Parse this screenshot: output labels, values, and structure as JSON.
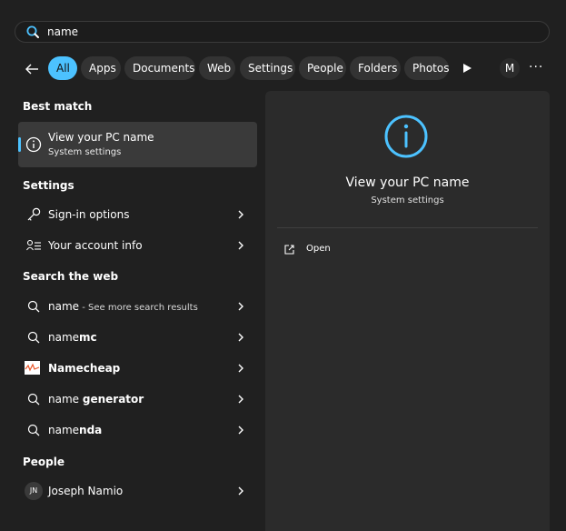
{
  "search": {
    "query": "name"
  },
  "filters": {
    "chips": [
      "All",
      "Apps",
      "Documents",
      "Web",
      "Settings",
      "People",
      "Folders",
      "Photos"
    ],
    "active": "All",
    "account_initial": "M"
  },
  "best_match": {
    "heading": "Best match",
    "title": "View your PC name",
    "subtitle": "System settings"
  },
  "settings_section": {
    "heading": "Settings",
    "items": [
      "Sign-in options",
      "Your account info"
    ]
  },
  "web_section": {
    "heading": "Search the web",
    "items": [
      {
        "prefix": "name",
        "bold": "",
        "sub": " - See more search results"
      },
      {
        "prefix": "name",
        "bold": "mc",
        "sub": ""
      },
      {
        "prefix": "",
        "bold": "Namecheap",
        "sub": ""
      },
      {
        "prefix": "name ",
        "bold": "generator",
        "sub": ""
      },
      {
        "prefix": "name",
        "bold": "nda",
        "sub": ""
      }
    ]
  },
  "people_section": {
    "heading": "People",
    "person": {
      "initials": "JN",
      "name": "Joseph Namio"
    }
  },
  "detail": {
    "title": "View your PC name",
    "subtitle": "System settings",
    "action": "Open"
  },
  "colors": {
    "accent": "#4cc2ff",
    "background": "#202020",
    "panel": "#2b2b2b"
  }
}
